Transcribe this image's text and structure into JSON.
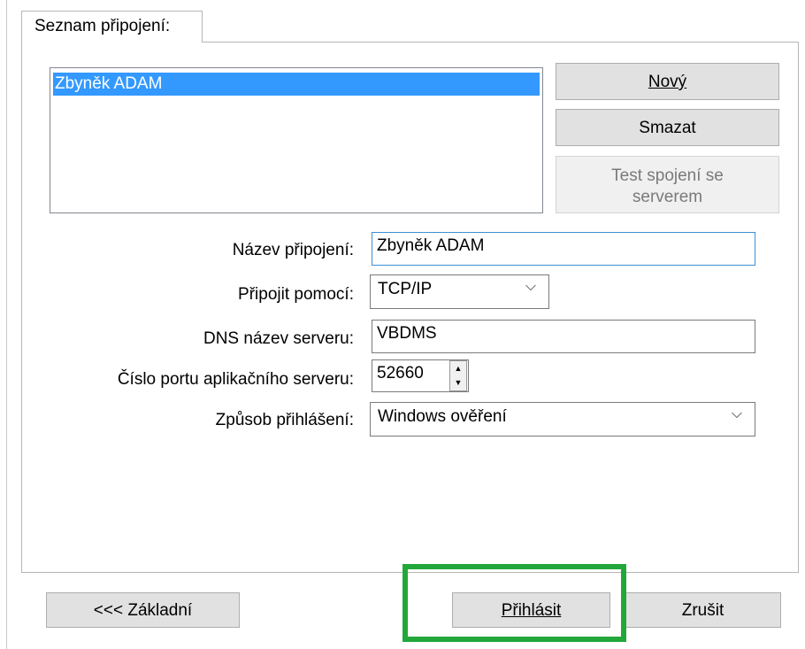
{
  "tab": {
    "label": "Seznam připojení:"
  },
  "connections": {
    "items": [
      "Zbyněk ADAM"
    ],
    "selected_index": 0
  },
  "buttons": {
    "new": "Nový",
    "delete": "Smazat",
    "test_line1": "Test spojení se",
    "test_line2": "serverem",
    "basic": "<<< Základní",
    "login": "Přihlásit",
    "cancel": "Zrušit"
  },
  "form": {
    "name_label": "Název připojení:",
    "name_value": "Zbyněk ADAM",
    "connect_label": "Připojit pomocí:",
    "connect_value": "TCP/IP",
    "dns_label": "DNS název serveru:",
    "dns_value": "VBDMS",
    "port_label": "Číslo portu aplikačního serveru:",
    "port_value": "52660",
    "auth_label": "Způsob přihlášení:",
    "auth_value": "Windows ověření"
  },
  "colors": {
    "selection": "#3399ff",
    "highlight_frame": "#22a83a",
    "focus_border": "#3d8fd6"
  }
}
